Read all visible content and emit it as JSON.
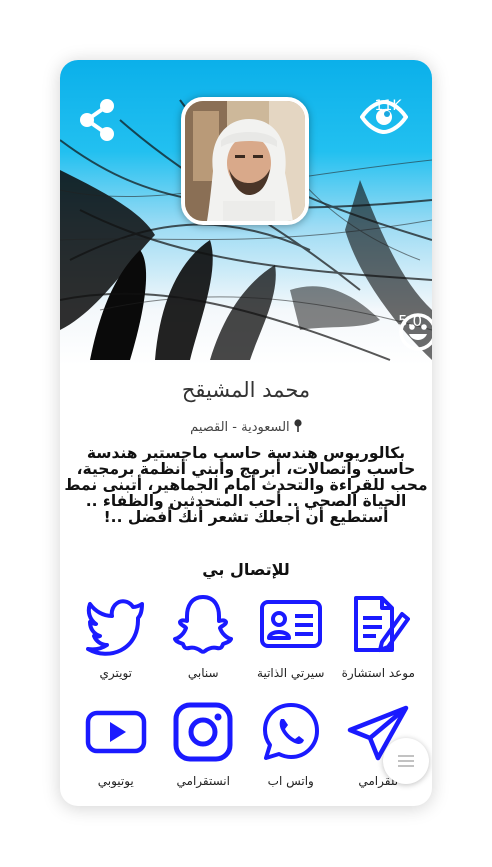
{
  "profile": {
    "name": "محمد المشيقح",
    "location": "السعودية - القصيم",
    "bio": "بكالوريوس هندسة حاسب ماجستير هندسة حاسب واتصالات، أبرمج وأبني أنظمة برمجية، محب للقراءة والتحدث أمام الجماهير، أتبنى نمط الحياة الصحي .. أحب المتحدثين والظفاء .. أستطيع أن أجعلك تشعر أنك أفضل ..!",
    "views": "11K",
    "rating": "5.0"
  },
  "icons": {
    "share": "share-icon",
    "views": "eye-icon",
    "rating": "smiley-icon",
    "pin": "pin-icon",
    "fab": "menu-lines-icon"
  },
  "contact": {
    "title": "للإتصال بي",
    "items": [
      {
        "label": "موعد استشارة",
        "icon": "document-pen-icon"
      },
      {
        "label": "سيرتي الذاتية",
        "icon": "id-card-icon"
      },
      {
        "label": "سنابي",
        "icon": "snapchat-ghost-icon"
      },
      {
        "label": "تويتري",
        "icon": "twitter-bird-icon"
      },
      {
        "label": "تلقرامي",
        "icon": "telegram-plane-icon"
      },
      {
        "label": "واتس اب",
        "icon": "whatsapp-icon"
      },
      {
        "label": "انستقرامي",
        "icon": "instagram-icon"
      },
      {
        "label": "يوتيوبي",
        "icon": "youtube-icon"
      }
    ]
  },
  "colors": {
    "accent": "#1a1aff",
    "cover_top": "#0bb0ea"
  }
}
